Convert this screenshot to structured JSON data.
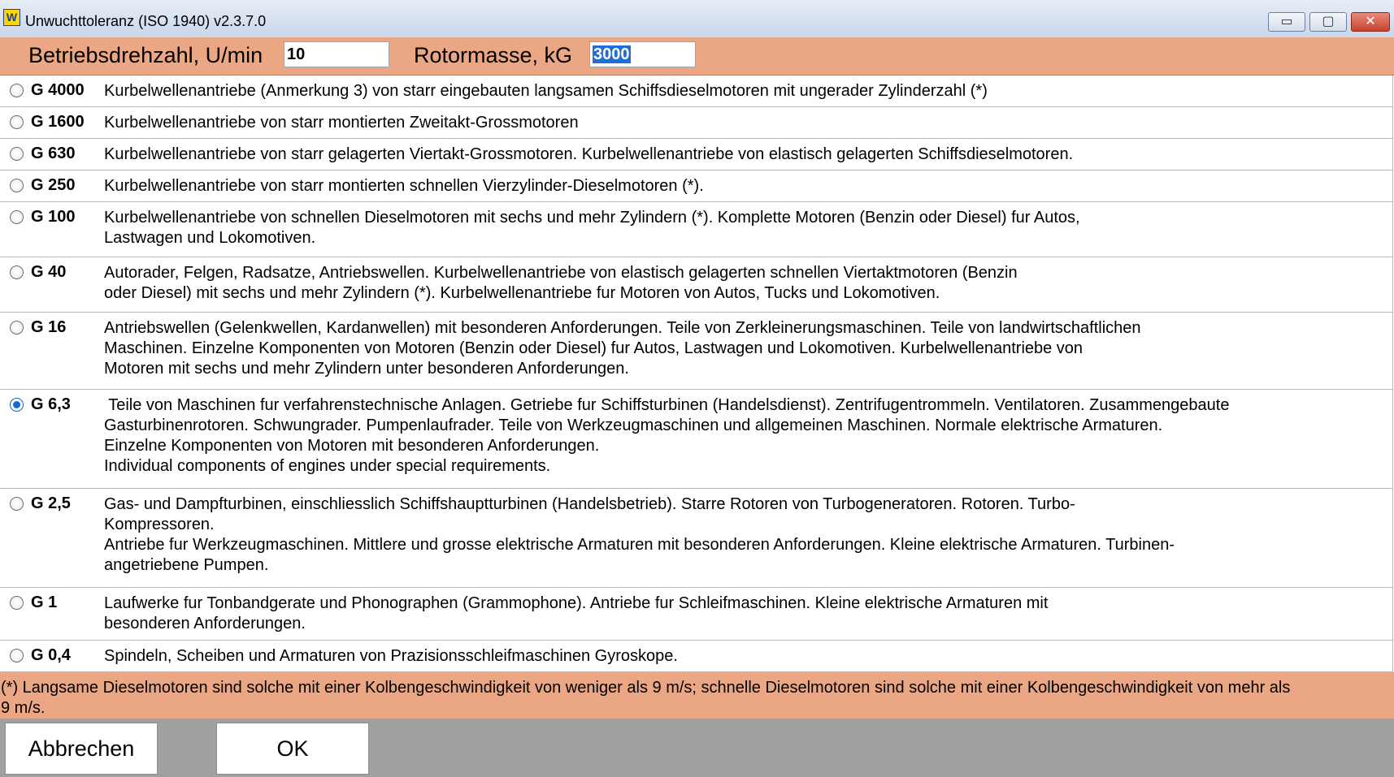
{
  "window": {
    "title": "Unwuchttoleranz (ISO 1940) v2.3.7.0",
    "icon_letter": "W",
    "minimize_glyph": "▭",
    "maximize_glyph": "▢",
    "close_glyph": "✕"
  },
  "header": {
    "speed_label": "Betriebsdrehzahl, U/min",
    "speed_value": "10",
    "mass_label": "Rotormasse, kG",
    "mass_value": "3000"
  },
  "classes": [
    {
      "grade": "G 4000",
      "checked": false,
      "text": "Kurbelwellenantriebe (Anmerkung 3) von starr eingebauten langsamen Schiffsdieselmotoren mit ungerader Zylinderzahl (*)"
    },
    {
      "grade": "G 1600",
      "checked": false,
      "text": "Kurbelwellenantriebe von starr montierten Zweitakt-Grossmotoren"
    },
    {
      "grade": "G 630",
      "checked": false,
      "text": "Kurbelwellenantriebe von starr gelagerten Viertakt-Grossmotoren. Kurbelwellenantriebe von elastisch gelagerten Schiffsdieselmotoren."
    },
    {
      "grade": "G 250",
      "checked": false,
      "text": "Kurbelwellenantriebe von starr montierten schnellen Vierzylinder-Dieselmotoren (*)."
    },
    {
      "grade": "G 100",
      "checked": false,
      "text": "Kurbelwellenantriebe von schnellen Dieselmotoren mit sechs und mehr Zylindern (*). Komplette Motoren (Benzin oder Diesel) fur Autos,\nLastwagen und Lokomotiven."
    },
    {
      "grade": "G 40",
      "checked": false,
      "text": "Autorader, Felgen, Radsatze, Antriebswellen. Kurbelwellenantriebe von elastisch gelagerten schnellen Viertaktmotoren (Benzin\noder Diesel) mit sechs und mehr Zylindern (*). Kurbelwellenantriebe fur Motoren von Autos, Tucks und Lokomotiven."
    },
    {
      "grade": "G 16",
      "checked": false,
      "text": "Antriebswellen (Gelenkwellen, Kardanwellen) mit besonderen Anforderungen. Teile von Zerkleinerungsmaschinen. Teile von landwirtschaftlichen\nMaschinen. Einzelne Komponenten von Motoren (Benzin oder Diesel) fur Autos, Lastwagen und Lokomotiven. Kurbelwellenantriebe von\nMotoren mit sechs und mehr Zylindern unter besonderen Anforderungen."
    },
    {
      "grade": "G 6,3",
      "checked": true,
      "text": " Teile von Maschinen fur verfahrenstechnische Anlagen. Getriebe fur Schiffsturbinen (Handelsdienst). Zentrifugentrommeln. Ventilatoren. Zusammengebaute\nGasturbinenrotoren. Schwungrader. Pumpenlaufrader. Teile von Werkzeugmaschinen und allgemeinen Maschinen. Normale elektrische Armaturen.\nEinzelne Komponenten von Motoren mit besonderen Anforderungen.\nIndividual components of engines under special requirements."
    },
    {
      "grade": "G 2,5",
      "checked": false,
      "text": "Gas- und Dampfturbinen, einschliesslich Schiffshauptturbinen (Handelsbetrieb). Starre Rotoren von Turbogeneratoren. Rotoren. Turbo-\nKompressoren.\nAntriebe fur Werkzeugmaschinen. Mittlere und grosse elektrische Armaturen mit besonderen Anforderungen. Kleine elektrische Armaturen. Turbinen-\nangetriebene Pumpen."
    },
    {
      "grade": "G 1",
      "checked": false,
      "text": "Laufwerke fur Tonbandgerate und Phonographen (Grammophone). Antriebe fur Schleifmaschinen. Kleine elektrische Armaturen mit\nbesonderen Anforderungen."
    },
    {
      "grade": "G 0,4",
      "checked": false,
      "text": "Spindeln, Scheiben und Armaturen von Prazisionsschleifmaschinen Gyroskope."
    }
  ],
  "footnote": "(*) Langsame Dieselmotoren sind solche mit einer Kolbengeschwindigkeit von weniger als 9 m/s; schnelle Dieselmotoren sind solche mit einer Kolbengeschwindigkeit von mehr als\n9 m/s.",
  "buttons": {
    "cancel": "Abbrechen",
    "ok": "OK"
  },
  "colors": {
    "accent": "#eba684",
    "bottom_bar": "#a0a0a0",
    "radio_checked": "#1a67d2"
  }
}
